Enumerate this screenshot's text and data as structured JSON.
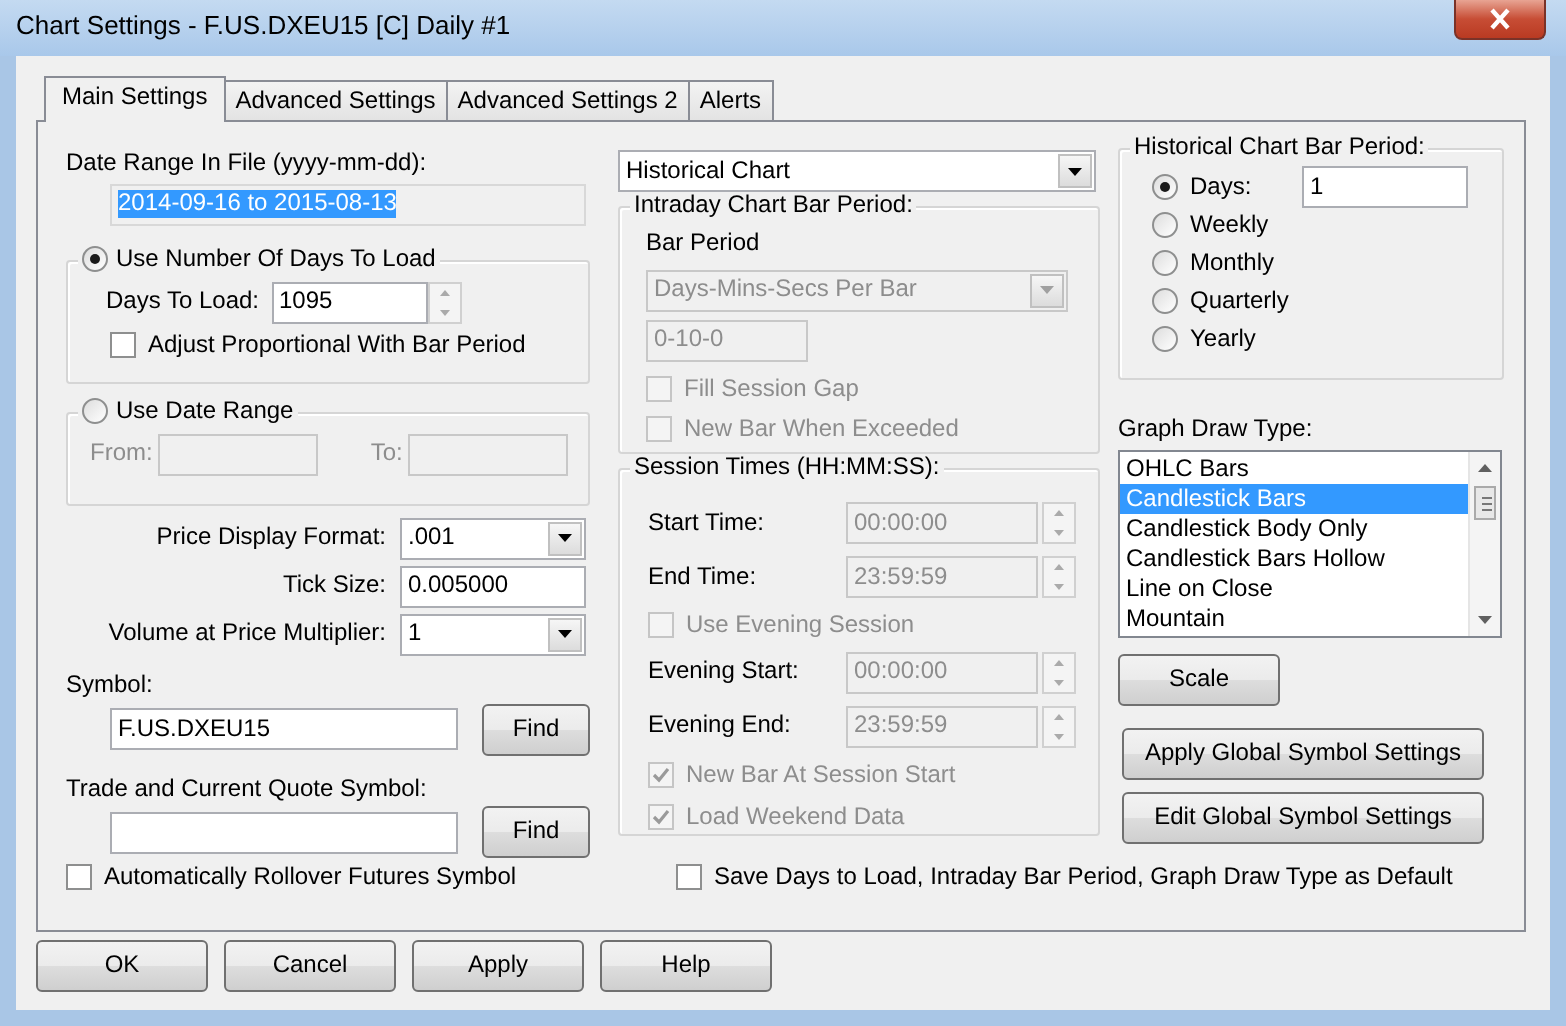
{
  "window": {
    "title": "Chart Settings - F.US.DXEU15 [C]  Daily  #1"
  },
  "tabs": [
    {
      "label": "Main Settings",
      "selected": true
    },
    {
      "label": "Advanced Settings",
      "selected": false
    },
    {
      "label": "Advanced Settings 2",
      "selected": false
    },
    {
      "label": "Alerts",
      "selected": false
    }
  ],
  "date_range": {
    "label": "Date Range In File (yyyy-mm-dd):",
    "value": "2014-09-16 to 2015-08-13"
  },
  "days_group": {
    "label": "Use Number Of Days To Load",
    "selected": true,
    "days_label": "Days To Load:",
    "days_value": "1095",
    "adjust": {
      "label": "Adjust Proportional With Bar Period",
      "checked": false
    }
  },
  "date_range_group": {
    "label": "Use Date Range",
    "selected": false,
    "from_label": "From:",
    "to_label": "To:"
  },
  "fields": [
    {
      "kind": "dropdown",
      "label": "Price Display Format:",
      "value": ".001"
    },
    {
      "kind": "text",
      "label": "Tick Size:",
      "value": "0.005000"
    },
    {
      "kind": "dropdown",
      "label": "Volume at Price Multiplier:",
      "value": "1"
    }
  ],
  "symbols": [
    {
      "label": "Symbol:",
      "value": "F.US.DXEU15",
      "button": "Find"
    },
    {
      "label": "Trade and Current Quote Symbol:",
      "button": "Find"
    }
  ],
  "auto_rollover": {
    "label": "Automatically Rollover Futures Symbol",
    "checked": false
  },
  "chart_type": {
    "value": "Historical Chart"
  },
  "intraday": {
    "title": "Intraday Chart Bar Period:",
    "disabled": true,
    "bar_period_label": "Bar Period",
    "bar_period_type": "Days-Mins-Secs Per Bar",
    "bar_period_value": "0-10-0",
    "options": [
      {
        "label": "Fill Session Gap",
        "checked": false
      },
      {
        "label": "New Bar When Exceeded",
        "checked": false
      }
    ]
  },
  "session": {
    "title": "Session Times (HH:MM:SS):",
    "disabled": true,
    "rows": [
      {
        "kind": "time",
        "label": "Start Time:",
        "value": "00:00:00"
      },
      {
        "kind": "time",
        "label": "End Time:",
        "value": "23:59:59"
      },
      {
        "kind": "check",
        "label": "Use Evening Session",
        "checked": false
      },
      {
        "kind": "time",
        "label": "Evening Start:",
        "value": "00:00:00"
      },
      {
        "kind": "time",
        "label": "Evening End:",
        "value": "23:59:59"
      },
      {
        "kind": "check",
        "label": "New Bar At Session Start",
        "checked": true
      },
      {
        "kind": "check",
        "label": "Load Weekend Data",
        "checked": true
      }
    ]
  },
  "historical": {
    "title": "Historical Chart Bar Period:",
    "periods": [
      {
        "label": "Days:",
        "selected": true,
        "value": "1"
      },
      {
        "label": "Weekly",
        "selected": false
      },
      {
        "label": "Monthly",
        "selected": false
      },
      {
        "label": "Quarterly",
        "selected": false
      },
      {
        "label": "Yearly",
        "selected": false
      }
    ]
  },
  "graph_draw_type": {
    "label": "Graph Draw Type:",
    "items": [
      {
        "label": "OHLC Bars",
        "selected": false
      },
      {
        "label": "Candlestick Bars",
        "selected": true
      },
      {
        "label": "Candlestick Body Only",
        "selected": false
      },
      {
        "label": "Candlestick Bars Hollow",
        "selected": false
      },
      {
        "label": "Line on Close",
        "selected": false
      },
      {
        "label": "Mountain",
        "selected": false
      }
    ]
  },
  "side_buttons": [
    "Scale",
    "Apply Global Symbol Settings",
    "Edit Global Symbol Settings"
  ],
  "save_default": {
    "label": "Save Days to Load, Intraday Bar Period, Graph Draw Type as Default",
    "checked": false
  },
  "buttons": [
    "OK",
    "Cancel",
    "Apply",
    "Help"
  ]
}
